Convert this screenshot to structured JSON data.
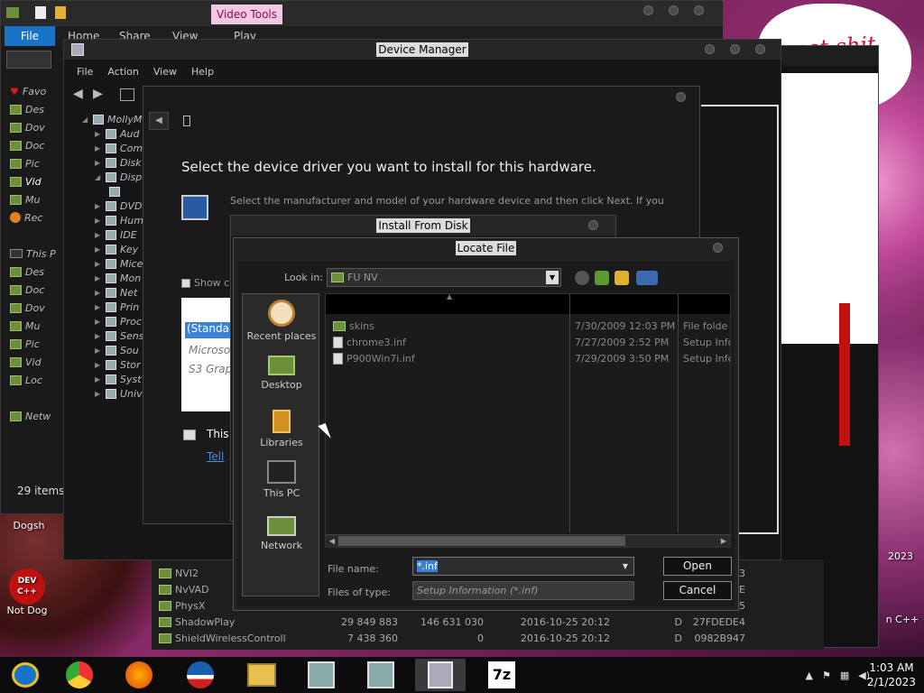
{
  "explorer": {
    "ribbon_contextual": "Video Tools",
    "tab_file": "File",
    "tab_home": "Home",
    "tab_share": "Share",
    "tab_view": "View",
    "tab_play": "Play",
    "nav": [
      "Favo",
      "Des",
      "Dov",
      "Doc",
      "Pic",
      "Vid",
      "Mu",
      "Rec",
      "This P",
      "Des",
      "Doc",
      "Dov",
      "Mu",
      "Pic",
      "Vid",
      "Loc",
      "Netw"
    ],
    "status": "29 items"
  },
  "device_manager": {
    "title": "Device Manager",
    "menu": [
      "File",
      "Action",
      "View",
      "Help"
    ],
    "tree": [
      "MollyMo",
      "Aud",
      "Com",
      "Disk",
      "Disp",
      "DVD",
      "Hum",
      "IDE",
      "Key",
      "Mice",
      "Mon",
      "Net",
      "Prin",
      "Proc",
      "Sens",
      "Sou",
      "Stor",
      "Syst",
      "Univ"
    ]
  },
  "wizard": {
    "heading": "Select the device driver you want to install for this hardware.",
    "description": "Select the manufacturer and model of your hardware device and then click Next. If you",
    "show_label": "Show c",
    "list_highlight": "(Standar",
    "list_items": [
      "Microso",
      "S3 Grap"
    ],
    "this_text": "This",
    "link_text": "Tell"
  },
  "install_from_disk": {
    "title": "Install From Disk"
  },
  "locate_file": {
    "title": "Locate File",
    "look_in_label": "Look in:",
    "look_in_value": "FU NV",
    "places": [
      "Recent places",
      "Desktop",
      "Libraries",
      "This PC",
      "Network"
    ],
    "files": [
      {
        "name": "skins",
        "date": "7/30/2009 12:03 PM",
        "type": "File folde",
        "kind": "folder"
      },
      {
        "name": "chrome3.inf",
        "date": "7/27/2009 2:52 PM",
        "type": "Setup Info",
        "kind": "doc"
      },
      {
        "name": "P900Win7i.inf",
        "date": "7/29/2009 3:50 PM",
        "type": "Setup Info",
        "kind": "doc"
      }
    ],
    "file_name_label": "File name:",
    "file_name_value": "*.inf",
    "files_of_type_label": "Files of type:",
    "files_of_type_value": "Setup Information (*.inf)",
    "open_button": "Open",
    "cancel_button": "Cancel"
  },
  "background_list": [
    {
      "name": "NVI2",
      "a": "",
      "b": "",
      "d": "",
      "e": "",
      "f": "3"
    },
    {
      "name": "NvVAD",
      "a": "",
      "b": "",
      "d": "",
      "e": "",
      "f": "E"
    },
    {
      "name": "PhysX",
      "a": "",
      "b": "",
      "d": "",
      "e": "",
      "f": "5"
    },
    {
      "name": "ShadowPlay",
      "a": "29 849 883",
      "b": "146 631 030",
      "d": "2016-10-25 20:12",
      "e": "D",
      "f": "27FDEDE4"
    },
    {
      "name": "ShieldWirelessControll",
      "a": "7 438 360",
      "b": "0",
      "d": "2016-10-25 20:12",
      "e": "D",
      "f": "0982B947"
    }
  ],
  "desktop": {
    "speech_text": "eet shit",
    "icons": [
      "Dogsh",
      "Not Dog",
      "n C++",
      "2023"
    ],
    "devcpp_logo": "DEV C++"
  },
  "taskbar": {
    "apps": [
      "explorer",
      "chrome",
      "firefox",
      "obama",
      "files",
      "setup1",
      "setup2",
      "device-installer",
      "7zip"
    ],
    "sevenzip_label": "7z",
    "time": "1:03 AM",
    "date": "2/1/2023"
  }
}
